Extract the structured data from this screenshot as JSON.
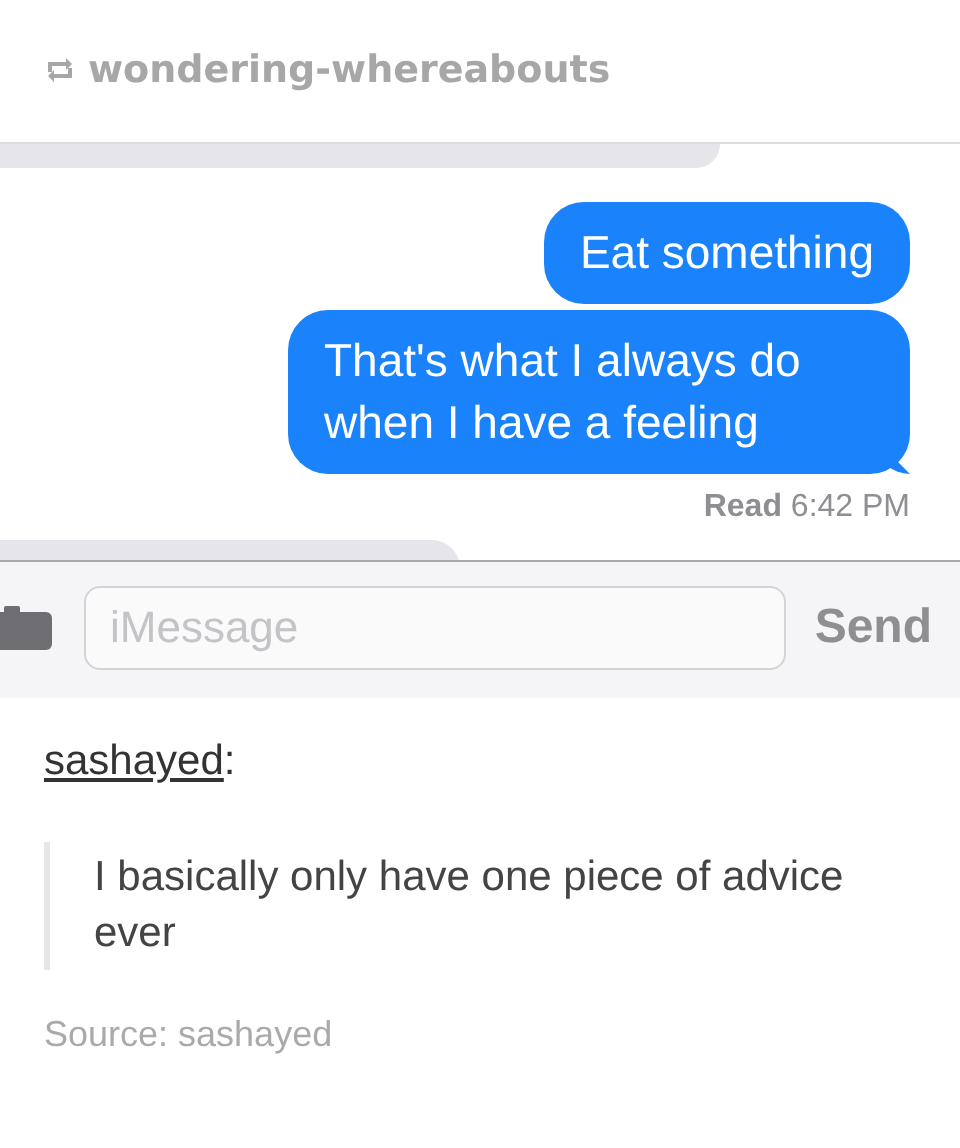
{
  "reblog": {
    "blog_name": "wondering-whereabouts"
  },
  "conversation": {
    "messages": [
      {
        "kind": "received"
      },
      {
        "kind": "sent",
        "text": "Eat something"
      },
      {
        "kind": "sent",
        "text": "That's what I always do when I have a feeling"
      },
      {
        "kind": "receipt",
        "text": "**Read** 6:42 PM"
      },
      {
        "kind": "received"
      }
    ],
    "input": {
      "placeholder": "iMessage"
    },
    "send_button": {
      "label": "Send",
      "disabled": true
    }
  },
  "post": {
    "author": "sashayed",
    "separator": ":",
    "quote": "I basically only have one piece of advice ever",
    "source": "Source: sashayed"
  }
}
